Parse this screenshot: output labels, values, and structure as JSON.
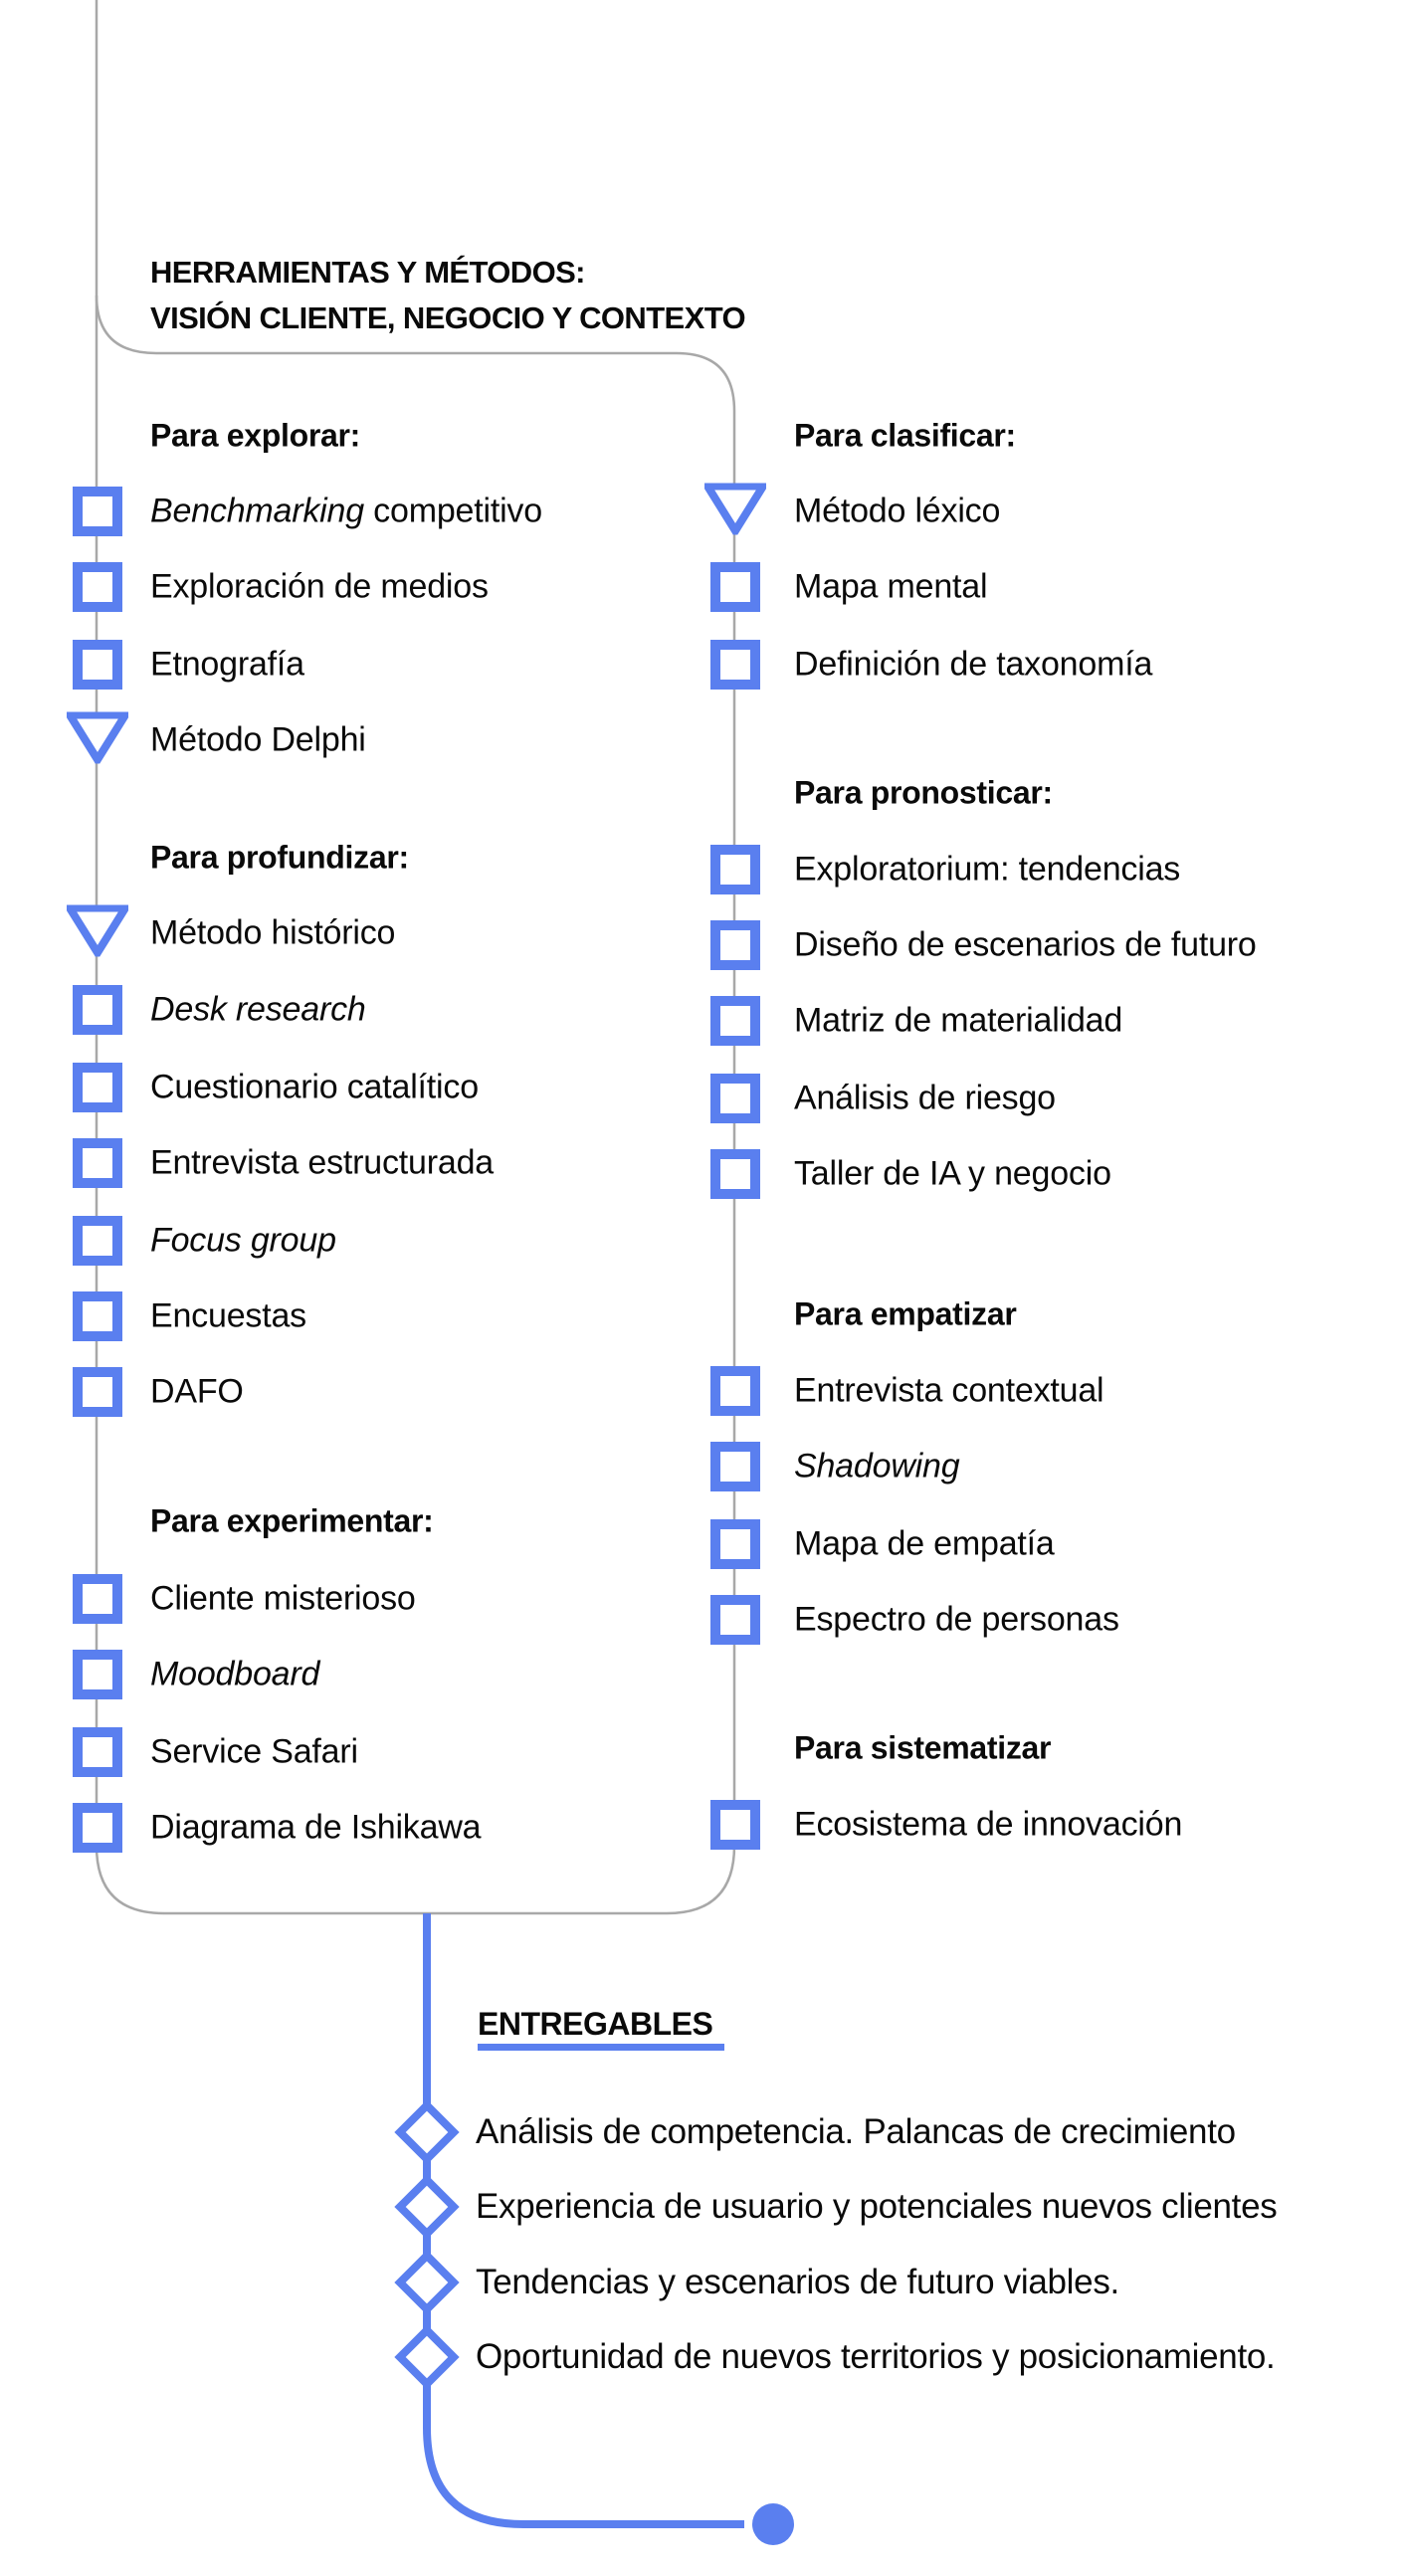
{
  "colors": {
    "accent": "#5A7FEF",
    "line": "#A8A8A8",
    "text": "#0A0A0A"
  },
  "header": {
    "title_line1": "HERRAMIENTAS Y MÉTODOS:",
    "title_line2": "VISIÓN CLIENTE, NEGOCIO Y CONTEXTO"
  },
  "left_column": [
    {
      "heading": "Para explorar:",
      "items": [
        {
          "marker": "square-icon",
          "parts": [
            {
              "text": "Benchmarking",
              "italic": true
            },
            {
              "text": " competitivo",
              "italic": false
            }
          ]
        },
        {
          "marker": "square-icon",
          "parts": [
            {
              "text": "Exploración de medios",
              "italic": false
            }
          ]
        },
        {
          "marker": "square-icon",
          "parts": [
            {
              "text": "Etnografía",
              "italic": false
            }
          ]
        },
        {
          "marker": "triangle-down-icon",
          "parts": [
            {
              "text": "Método Delphi",
              "italic": false
            }
          ]
        }
      ]
    },
    {
      "heading": "Para profundizar:",
      "items": [
        {
          "marker": "triangle-down-icon",
          "parts": [
            {
              "text": "Método histórico",
              "italic": false
            }
          ]
        },
        {
          "marker": "square-icon",
          "parts": [
            {
              "text": "Desk research",
              "italic": true
            }
          ]
        },
        {
          "marker": "square-icon",
          "parts": [
            {
              "text": "Cuestionario catalítico",
              "italic": false
            }
          ]
        },
        {
          "marker": "square-icon",
          "parts": [
            {
              "text": "Entrevista estructurada",
              "italic": false
            }
          ]
        },
        {
          "marker": "square-icon",
          "parts": [
            {
              "text": "Focus group",
              "italic": true
            }
          ]
        },
        {
          "marker": "square-icon",
          "parts": [
            {
              "text": "Encuestas",
              "italic": false
            }
          ]
        },
        {
          "marker": "square-icon",
          "parts": [
            {
              "text": "DAFO",
              "italic": false
            }
          ]
        }
      ]
    },
    {
      "heading": "Para experimentar:",
      "items": [
        {
          "marker": "square-icon",
          "parts": [
            {
              "text": "Cliente misterioso",
              "italic": false
            }
          ]
        },
        {
          "marker": "square-icon",
          "parts": [
            {
              "text": "Moodboard",
              "italic": true
            }
          ]
        },
        {
          "marker": "square-icon",
          "parts": [
            {
              "text": "Service Safari",
              "italic": false
            }
          ]
        },
        {
          "marker": "square-icon",
          "parts": [
            {
              "text": "Diagrama de Ishikawa",
              "italic": false
            }
          ]
        }
      ]
    }
  ],
  "right_column": [
    {
      "heading": "Para clasificar:",
      "items": [
        {
          "marker": "triangle-down-icon",
          "parts": [
            {
              "text": "Método léxico",
              "italic": false
            }
          ]
        },
        {
          "marker": "square-icon",
          "parts": [
            {
              "text": "Mapa mental",
              "italic": false
            }
          ]
        },
        {
          "marker": "square-icon",
          "parts": [
            {
              "text": "Definición de taxonomía",
              "italic": false
            }
          ]
        }
      ]
    },
    {
      "heading": "Para pronosticar:",
      "items": [
        {
          "marker": "square-icon",
          "parts": [
            {
              "text": "Exploratorium: tendencias",
              "italic": false
            }
          ]
        },
        {
          "marker": "square-icon",
          "parts": [
            {
              "text": "Diseño de escenarios de futuro",
              "italic": false
            }
          ]
        },
        {
          "marker": "square-icon",
          "parts": [
            {
              "text": "Matriz de materialidad",
              "italic": false
            }
          ]
        },
        {
          "marker": "square-icon",
          "parts": [
            {
              "text": "Análisis de riesgo",
              "italic": false
            }
          ]
        },
        {
          "marker": "square-icon",
          "parts": [
            {
              "text": "Taller de IA y negocio",
              "italic": false
            }
          ]
        }
      ]
    },
    {
      "heading": "Para empatizar",
      "items": [
        {
          "marker": "square-icon",
          "parts": [
            {
              "text": "Entrevista contextual",
              "italic": false
            }
          ]
        },
        {
          "marker": "square-icon",
          "parts": [
            {
              "text": "Shadowing",
              "italic": true
            }
          ]
        },
        {
          "marker": "square-icon",
          "parts": [
            {
              "text": "Mapa de empatía",
              "italic": false
            }
          ]
        },
        {
          "marker": "square-icon",
          "parts": [
            {
              "text": "Espectro de personas",
              "italic": false
            }
          ]
        }
      ]
    },
    {
      "heading": "Para sistematizar",
      "items": [
        {
          "marker": "square-icon",
          "parts": [
            {
              "text": "Ecosistema de innovación",
              "italic": false
            }
          ]
        }
      ]
    }
  ],
  "deliverables": {
    "title": "ENTREGABLES",
    "items": [
      "Análisis de competencia. Palancas de crecimiento",
      "Experiencia de usuario y potenciales nuevos clientes",
      "Tendencias y escenarios de futuro viables.",
      "Oportunidad de nuevos territorios y posicionamiento."
    ],
    "marker": "diamond-icon",
    "end_marker": "end-dot-icon"
  }
}
